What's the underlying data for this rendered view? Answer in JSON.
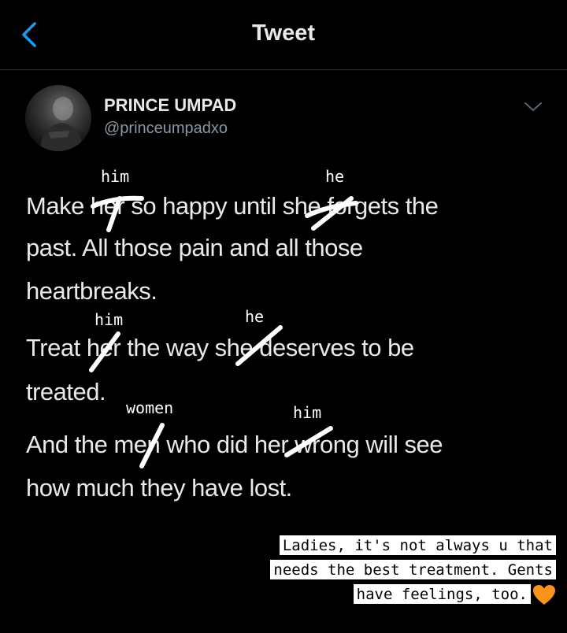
{
  "header": {
    "title": "Tweet"
  },
  "tweet": {
    "author_name": "PRINCE UMPAD",
    "author_handle": "@princeumpadxo",
    "lines": [
      "Make her so happy until she forgets the",
      "past. All those pain and all those",
      "heartbreaks.",
      "Treat her the way she deserves to be",
      "treated.",
      "And the men who did her wrong will see",
      "how much they have lost."
    ]
  },
  "handwritten_edits": [
    "him",
    "he",
    "him",
    "he",
    "women",
    "him"
  ],
  "caption": {
    "lines": [
      "Ladies, it's not always u that",
      "needs the best treatment. Gents",
      "have feelings, too."
    ],
    "emoji": "orange-heart"
  },
  "colors": {
    "accent": "#1d9bf0",
    "text": "#e7e9ea",
    "secondary": "#8b98a5",
    "background": "#000000"
  }
}
